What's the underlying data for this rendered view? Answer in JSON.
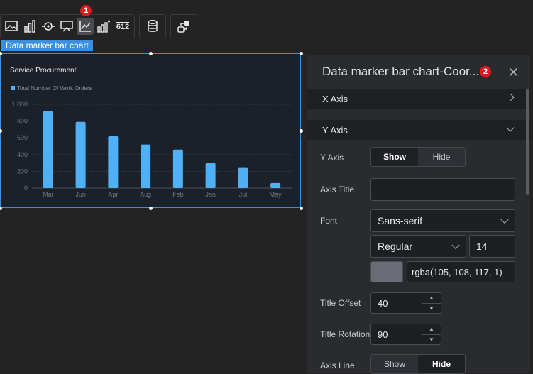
{
  "toolbar": {
    "groups": [
      [
        "image-icon",
        "bar-chart-icon",
        "gauge-icon",
        "map-icon",
        "coordinate-icon",
        "bar-number-icon",
        "counter-icon"
      ],
      [
        "database-icon"
      ],
      [
        "link-icon"
      ]
    ],
    "counter_text": "612",
    "badge_1": "1"
  },
  "chart_tag": "Data marker bar chart",
  "chart_data": {
    "type": "bar",
    "title": "Service Procurement",
    "legend": [
      "Total Number Of Work Orders"
    ],
    "categories": [
      "Mar",
      "Jun",
      "Apr",
      "Aug",
      "Feb",
      "Jan",
      "Jul",
      "May"
    ],
    "series": [
      {
        "name": "Total Number Of Work Orders",
        "values": [
          920,
          790,
          620,
          520,
          460,
          300,
          240,
          60
        ]
      }
    ],
    "ylim": [
      0,
      1000
    ],
    "yticks": [
      "0",
      "200",
      "400",
      "600",
      "800",
      "1,000"
    ],
    "grid": true,
    "bar_color": "#4fb0f5"
  },
  "panel": {
    "title": "Data marker bar chart-Coor...",
    "badge_2": "2",
    "x_axis_section": "X Axis",
    "y_axis_section": "Y Axis",
    "y_axis_label": "Y Axis",
    "show_label": "Show",
    "hide_label": "Hide",
    "axis_title_label": "Axis Title",
    "axis_title_value": "",
    "font_label": "Font",
    "font_family": "Sans-serif",
    "font_weight": "Regular",
    "font_size": "14",
    "font_color": "rgba(105, 108, 117, 1)",
    "title_offset_label": "Title Offset",
    "title_offset_value": "40",
    "title_rotation_label": "Title Rotation",
    "title_rotation_value": "90",
    "axis_line_label": "Axis Line"
  }
}
